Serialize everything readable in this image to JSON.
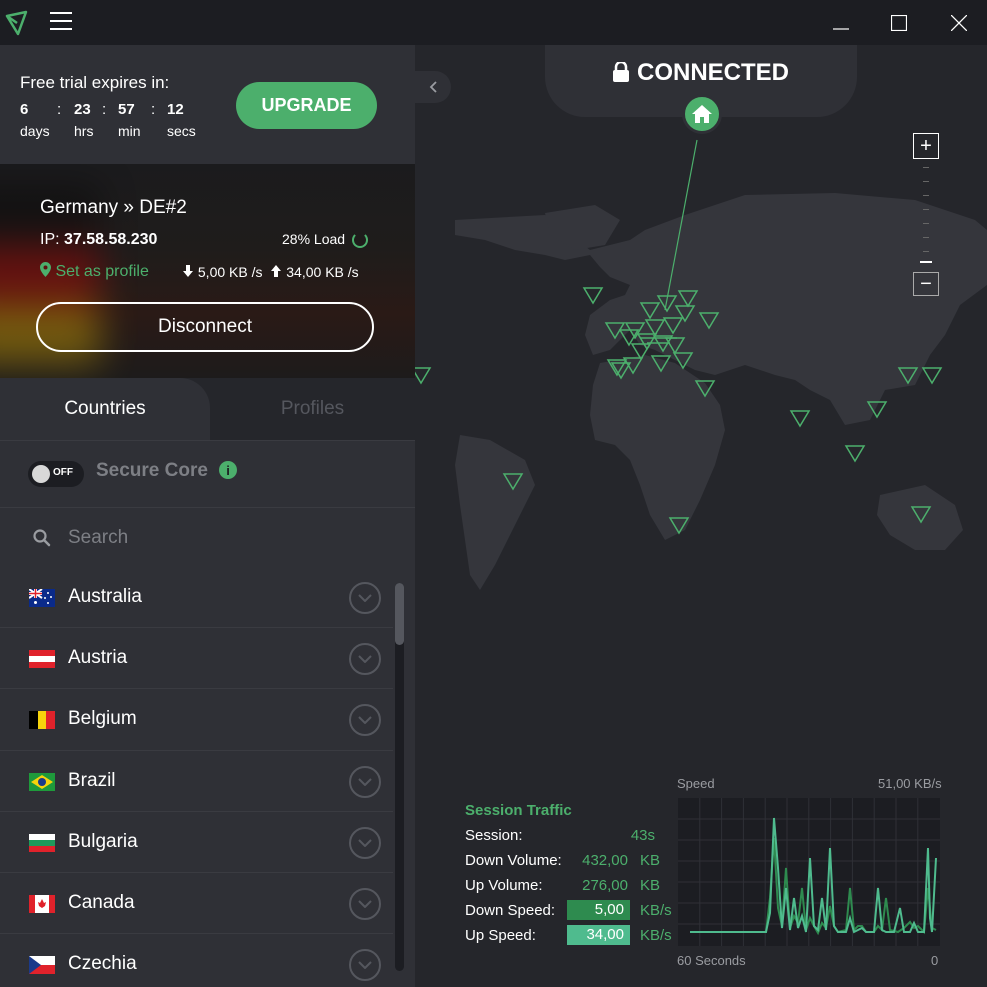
{
  "titlebar": {
    "logo_icon": "protonvpn-logo-icon",
    "menu_icon": "hamburger-icon",
    "controls": [
      "minimize-icon",
      "maximize-icon",
      "close-icon"
    ]
  },
  "trial": {
    "title": "Free trial expires in:",
    "countdown": [
      {
        "value": "6",
        "unit": "days"
      },
      {
        "value": "23",
        "unit": "hrs"
      },
      {
        "value": "57",
        "unit": "min"
      },
      {
        "value": "12",
        "unit": "secs"
      }
    ],
    "separator": ":",
    "upgrade_label": "UPGRADE"
  },
  "connection": {
    "server": "Germany » DE#2",
    "ip_label": "IP:",
    "ip": "37.58.58.230",
    "load": "28% Load",
    "set_profile": "Set as profile",
    "down_speed": "5,00 KB /s",
    "up_speed": "34,00 KB /s",
    "disconnect_label": "Disconnect"
  },
  "tabs": {
    "countries": "Countries",
    "profiles": "Profiles"
  },
  "secure_core": {
    "toggle_state": "OFF",
    "label": "Secure Core",
    "info_glyph": "i"
  },
  "search": {
    "placeholder": "Search"
  },
  "countries": [
    {
      "name": "Australia",
      "flag": "au"
    },
    {
      "name": "Austria",
      "flag": "at"
    },
    {
      "name": "Belgium",
      "flag": "be"
    },
    {
      "name": "Brazil",
      "flag": "br"
    },
    {
      "name": "Bulgaria",
      "flag": "bg"
    },
    {
      "name": "Canada",
      "flag": "ca"
    },
    {
      "name": "Czechia",
      "flag": "cz"
    }
  ],
  "map": {
    "status": "CONNECTED",
    "status_icon": "lock-icon",
    "home_icon": "home-icon",
    "zoom_in": "+",
    "zoom_out": "−",
    "collapse_icon": "chevron-left-icon"
  },
  "traffic": {
    "title": "Session Traffic",
    "rows": [
      {
        "label": "Session:",
        "value": "43s",
        "unit": ""
      },
      {
        "label": "Down Volume:",
        "value": "432,00",
        "unit": "KB"
      },
      {
        "label": "Up Volume:",
        "value": "276,00",
        "unit": "KB"
      },
      {
        "label": "Down Speed:",
        "value": "5,00",
        "unit": "KB/s"
      },
      {
        "label": "Up Speed:",
        "value": "34,00",
        "unit": "KB/s"
      }
    ],
    "graph": {
      "speed_label": "Speed",
      "max_label": "51,00  KB/s",
      "x_left": "60 Seconds",
      "x_right": "0"
    }
  },
  "colors": {
    "accent": "#4caf6c",
    "bg_dark": "#1c1d22",
    "panel": "#2f3036",
    "map_bg": "#25262b",
    "land": "#35363c",
    "down_bar": "#2e8b4f",
    "up_bar": "#4fbb8e"
  }
}
